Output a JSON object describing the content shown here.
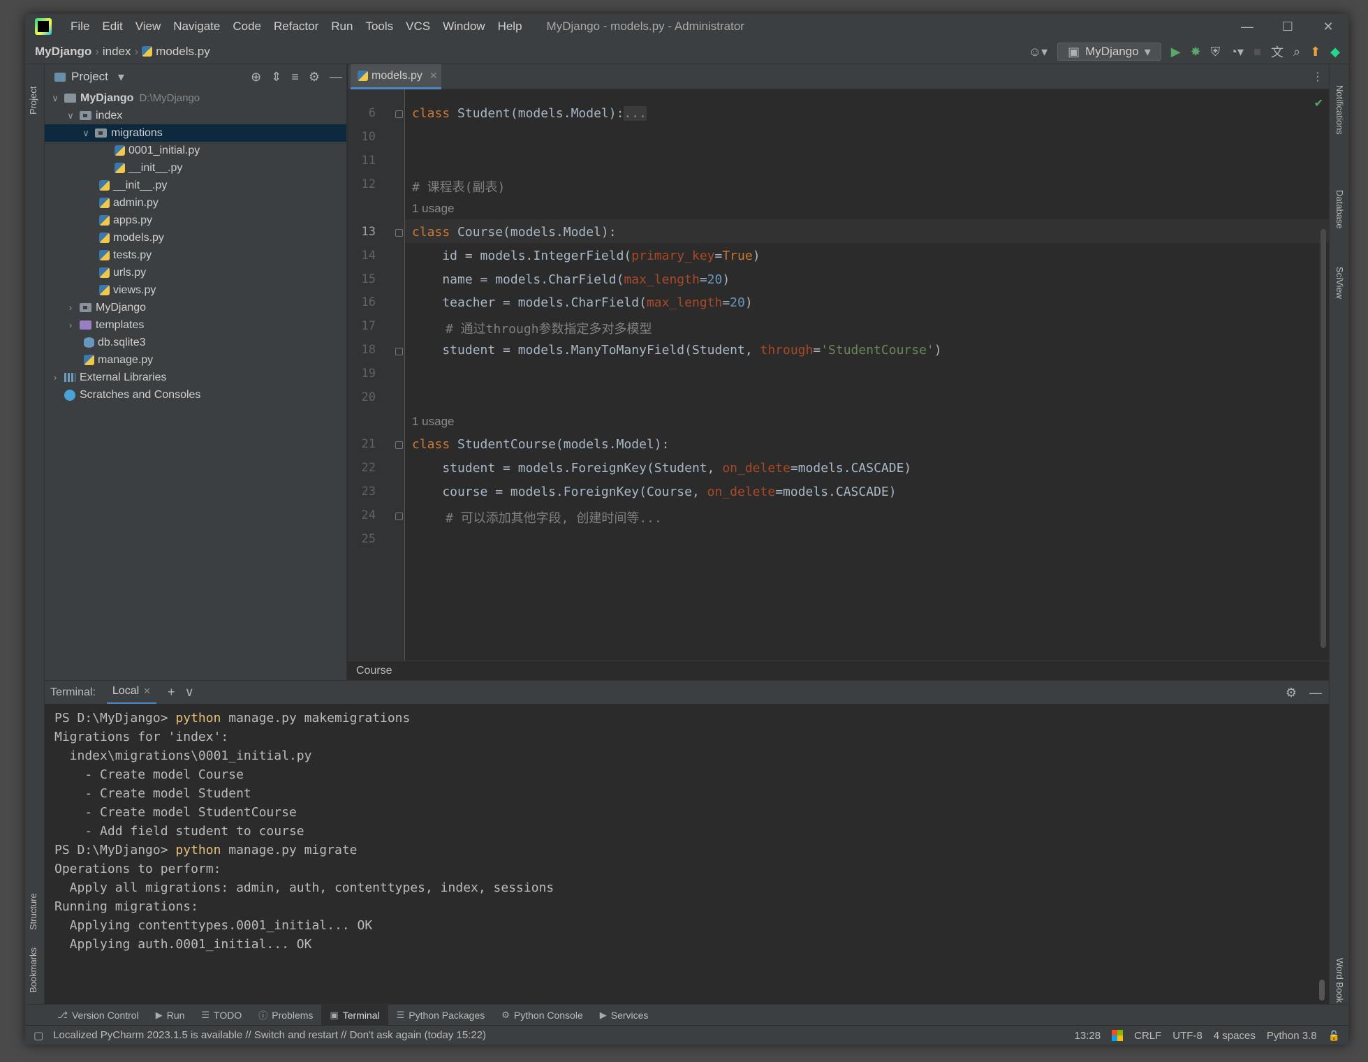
{
  "titlebar": {
    "menu": [
      "File",
      "Edit",
      "View",
      "Navigate",
      "Code",
      "Refactor",
      "Run",
      "Tools",
      "VCS",
      "Window",
      "Help"
    ],
    "title": "MyDjango - models.py - Administrator"
  },
  "navbar": {
    "crumbs": [
      "MyDjango",
      "index",
      "models.py"
    ],
    "run_config": "MyDjango"
  },
  "project": {
    "title": "Project",
    "tree": [
      {
        "label": "MyDjango",
        "path": "D:\\MyDjango"
      },
      {
        "label": "index"
      },
      {
        "label": "migrations"
      },
      {
        "label": "0001_initial.py"
      },
      {
        "label": "__init__.py"
      },
      {
        "label": "__init__.py"
      },
      {
        "label": "admin.py"
      },
      {
        "label": "apps.py"
      },
      {
        "label": "models.py"
      },
      {
        "label": "tests.py"
      },
      {
        "label": "urls.py"
      },
      {
        "label": "views.py"
      },
      {
        "label": "MyDjango"
      },
      {
        "label": "templates"
      },
      {
        "label": "db.sqlite3"
      },
      {
        "label": "manage.py"
      },
      {
        "label": "External Libraries"
      },
      {
        "label": "Scratches and Consoles"
      }
    ]
  },
  "editor": {
    "tab": "models.py",
    "line_numbers": [
      "6",
      "10",
      "11",
      "12",
      "",
      "13",
      "14",
      "15",
      "16",
      "17",
      "18",
      "19",
      "20",
      "",
      "21",
      "22",
      "23",
      "24",
      "25"
    ],
    "comment_course": "# 课程表(副表)",
    "usage": "1 usage",
    "comment_through": "# 通过through参数指定多对多模型",
    "comment_more": "# 可以添加其他字段, 创建时间等...",
    "breadcrumb": "Course"
  },
  "terminal": {
    "label": "Terminal:",
    "tab": "Local",
    "lines": [
      {
        "prefix": "PS D:\\MyDjango> ",
        "cmd": "python",
        "rest": " manage.py makemigrations"
      },
      {
        "text": "Migrations for 'index':"
      },
      {
        "text": "  index\\migrations\\0001_initial.py"
      },
      {
        "text": "    - Create model Course"
      },
      {
        "text": "    - Create model Student"
      },
      {
        "text": "    - Create model StudentCourse"
      },
      {
        "text": "    - Add field student to course"
      },
      {
        "prefix": "PS D:\\MyDjango> ",
        "cmd": "python",
        "rest": " manage.py migrate"
      },
      {
        "text": "Operations to perform:"
      },
      {
        "text": "  Apply all migrations: admin, auth, contenttypes, index, sessions"
      },
      {
        "text": "Running migrations:"
      },
      {
        "text": "  Applying contenttypes.0001_initial... OK"
      },
      {
        "text": "  Applying auth.0001_initial... OK"
      }
    ]
  },
  "side_tabs": {
    "left_top": "Project",
    "left_bottom": [
      "Structure",
      "Bookmarks"
    ],
    "right": [
      "Notifications",
      "Database",
      "SciView",
      "Word Book"
    ]
  },
  "toolwindows": [
    "Version Control",
    "Run",
    "TODO",
    "Problems",
    "Terminal",
    "Python Packages",
    "Python Console",
    "Services"
  ],
  "status": {
    "message": "Localized PyCharm 2023.1.5 is available // Switch and restart // Don't ask again (today 15:22)",
    "position": "13:28",
    "line_sep": "CRLF",
    "encoding": "UTF-8",
    "indent": "4 spaces",
    "interpreter": "Python 3.8"
  }
}
